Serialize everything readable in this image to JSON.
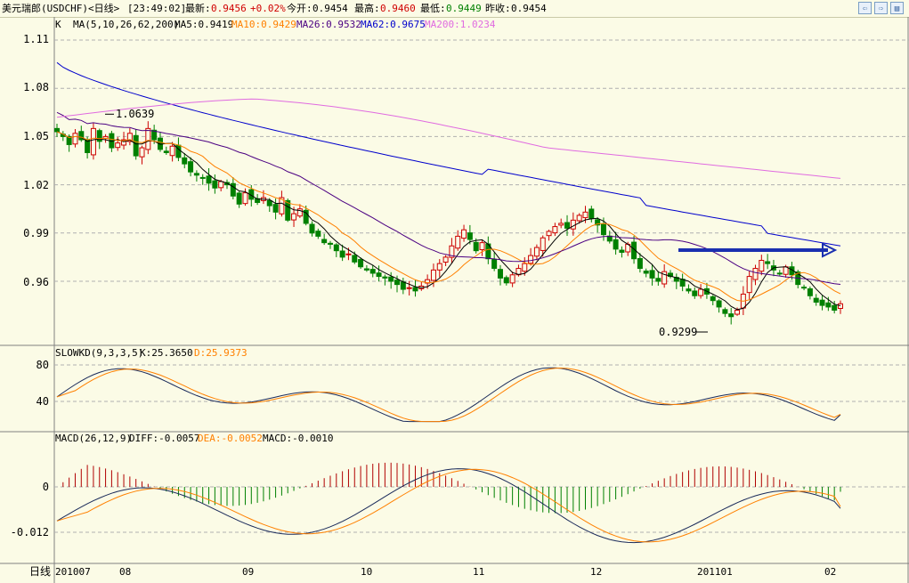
{
  "header": {
    "symbol": "美元瑞郎(USDCHF)<日线>",
    "time": "[23:49:02]",
    "latest_label": "最新:",
    "latest_value": "0.9456",
    "change": "+0.02%",
    "open_label": "今开:",
    "open_value": "0.9454",
    "high_label": "最高:",
    "high_value": "0.9460",
    "low_label": "最低:",
    "low_value": "0.9449",
    "prev_close_label": "昨收:",
    "prev_close_value": "0.9454",
    "nav_icons": [
      "prev-icon",
      "next-icon",
      "menu-icon"
    ],
    "nav_glyphs": [
      "⇦",
      "⇨",
      "▤"
    ]
  },
  "price_panel": {
    "mode_letter": "K",
    "ma_label": "MA(5,10,26,62,200)",
    "ma5": "MA5:0.9419",
    "ma10": "MA10:0.9429",
    "ma26": "MA26:0.9532",
    "ma62": "MA62:0.9675",
    "ma200": "MA200:1.0234",
    "y_ticks": [
      "1.11",
      "1.08",
      "1.05",
      "1.02",
      "0.99",
      "0.96"
    ],
    "high_annotation": "1.0639",
    "low_annotation": "0.9299"
  },
  "kd_panel": {
    "label": "SLOWKD(9,3,3,5)",
    "k": "K:25.3650",
    "d": "D:25.9373",
    "y_ticks": [
      "80",
      "40"
    ]
  },
  "macd_panel": {
    "label": "MACD(26,12,9)",
    "diff": "DIFF:-0.0057",
    "dea": "DEA:-0.0052",
    "macd": "MACD:-0.0010",
    "y_ticks": [
      "0",
      "-0.012"
    ]
  },
  "x_axis": {
    "period_label": "日线",
    "ticks": [
      "201007",
      "08",
      "09",
      "10",
      "11",
      "12",
      "201101",
      "02"
    ]
  },
  "colors": {
    "background": "#fbfbe6",
    "up_candle": "#cc0000",
    "down_candle": "#008000",
    "ma5": "#000000",
    "ma10": "#ff8000",
    "ma26": "#4b0082",
    "ma62": "#0000cc",
    "ma200": "#e06be0",
    "arrow": "#1a2fb0",
    "macd_up": "#b00000",
    "macd_down": "#008000"
  },
  "chart_data": {
    "type": "candlestick",
    "title": "美元瑞郎(USDCHF)<日线>",
    "ylim": [
      0.935,
      1.115
    ],
    "y_ticks": [
      1.11,
      1.08,
      1.05,
      1.02,
      0.99,
      0.96
    ],
    "x_ticks": [
      "201007",
      "08",
      "09",
      "10",
      "11",
      "12",
      "201101",
      "02"
    ],
    "highest": 1.0639,
    "lowest": 0.9299,
    "close_series_approx": [
      1.053,
      1.05,
      1.045,
      1.052,
      1.048,
      1.04,
      1.055,
      1.047,
      1.05,
      1.043,
      1.046,
      1.048,
      1.052,
      1.038,
      1.043,
      1.055,
      1.048,
      1.042,
      1.04,
      1.044,
      1.037,
      1.033,
      1.028,
      1.026,
      1.024,
      1.021,
      1.018,
      1.022,
      1.02,
      1.013,
      1.008,
      1.015,
      1.011,
      1.009,
      1.012,
      1.007,
      1.003,
      1.012,
      0.998,
      1.002,
      1.005,
      0.996,
      0.99,
      0.988,
      0.984,
      0.983,
      0.979,
      0.975,
      0.977,
      0.972,
      0.969,
      0.967,
      0.965,
      0.963,
      0.962,
      0.96,
      0.958,
      0.955,
      0.956,
      0.954,
      0.957,
      0.961,
      0.967,
      0.971,
      0.975,
      0.982,
      0.988,
      0.992,
      0.986,
      0.979,
      0.984,
      0.974,
      0.968,
      0.962,
      0.959,
      0.964,
      0.968,
      0.971,
      0.976,
      0.981,
      0.987,
      0.991,
      0.994,
      0.996,
      0.993,
      0.998,
      1.001,
      1.003,
      0.999,
      0.995,
      0.989,
      0.985,
      0.98,
      0.978,
      0.983,
      0.974,
      0.968,
      0.965,
      0.962,
      0.96,
      0.966,
      0.963,
      0.96,
      0.957,
      0.954,
      0.951,
      0.955,
      0.952,
      0.948,
      0.944,
      0.94,
      0.938,
      0.942,
      0.952,
      0.963,
      0.968,
      0.973,
      0.971,
      0.967,
      0.965,
      0.969,
      0.964,
      0.958,
      0.956,
      0.951,
      0.947,
      0.945,
      0.944,
      0.942,
      0.946
    ],
    "kd": {
      "k_last": 25.365,
      "d_last": 25.9373,
      "ylim": [
        0,
        100
      ],
      "y_ticks": [
        80,
        40
      ]
    },
    "macd": {
      "diff_last": -0.0057,
      "dea_last": -0.0052,
      "macd_last": -0.001,
      "y_ticks": [
        0,
        -0.012
      ]
    }
  }
}
